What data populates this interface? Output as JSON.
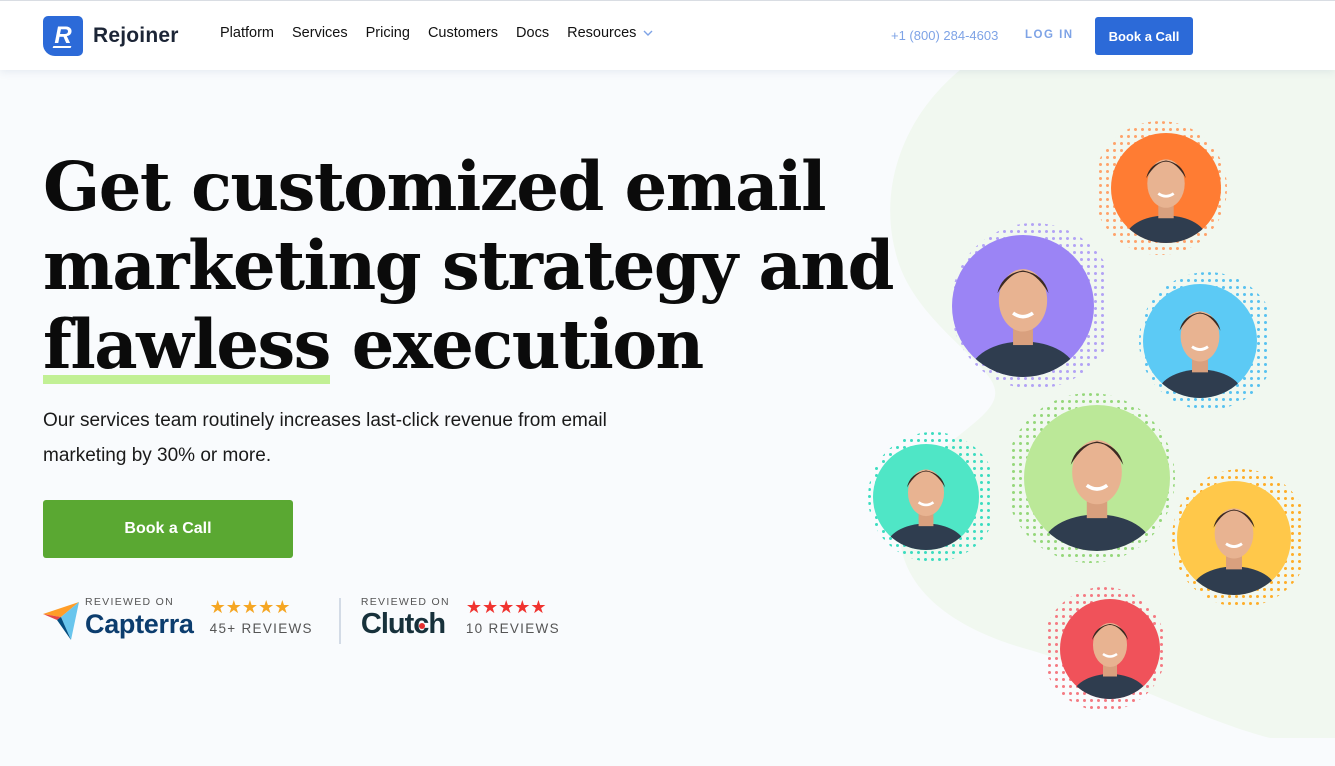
{
  "header": {
    "logo_text": "Rejoiner",
    "logo_letter": "R",
    "nav": [
      {
        "label": "Platform"
      },
      {
        "label": "Services"
      },
      {
        "label": "Pricing"
      },
      {
        "label": "Customers"
      },
      {
        "label": "Docs"
      },
      {
        "label": "Resources",
        "dropdown": true
      }
    ],
    "phone": "+1 (800) 284-4603",
    "login_label": "LOG IN",
    "cta_label": "Book a Call"
  },
  "hero": {
    "headline_line1": "Get customized email",
    "headline_line2": "marketing strategy and",
    "headline_highlight": "flawless",
    "headline_rest": " execution",
    "subtitle": "Our services team routinely increases last-click revenue from email marketing by 30% or more.",
    "cta_label": "Book a Call"
  },
  "reviews": [
    {
      "reviewed_on": "REVIEWED ON",
      "platform": "Capterra",
      "rating": 5,
      "stars": "★★★★★",
      "count_label": "45+ REVIEWS",
      "star_color": "#f5a623"
    },
    {
      "reviewed_on": "REVIEWED ON",
      "platform": "Clutch",
      "rating": 5,
      "stars": "★★★★★",
      "count_label": "10 REVIEWS",
      "star_color": "#f0332f"
    }
  ],
  "team_avatars": [
    {
      "name": "team-member-1",
      "bg_color": "#ff7c33",
      "dot_color": "#ffa36b"
    },
    {
      "name": "team-member-2",
      "bg_color": "#9b84f5",
      "dot_color": "#b3a3f5"
    },
    {
      "name": "team-member-3",
      "bg_color": "#5ccaf5",
      "dot_color": "#58c2f0"
    },
    {
      "name": "team-member-4",
      "bg_color": "#4fe6c6",
      "dot_color": "#3cdcc0"
    },
    {
      "name": "team-member-5",
      "bg_color": "#bbe898",
      "dot_color": "#95d77a"
    },
    {
      "name": "team-member-6",
      "bg_color": "#ffc84a",
      "dot_color": "#ffad28"
    },
    {
      "name": "team-member-7",
      "bg_color": "#f0525a",
      "dot_color": "#f47a82"
    }
  ],
  "colors": {
    "brand_blue": "#2c6ad8",
    "cta_green": "#5aa832",
    "highlight_green": "#c2f095",
    "link_blue": "#7ea3e6"
  }
}
